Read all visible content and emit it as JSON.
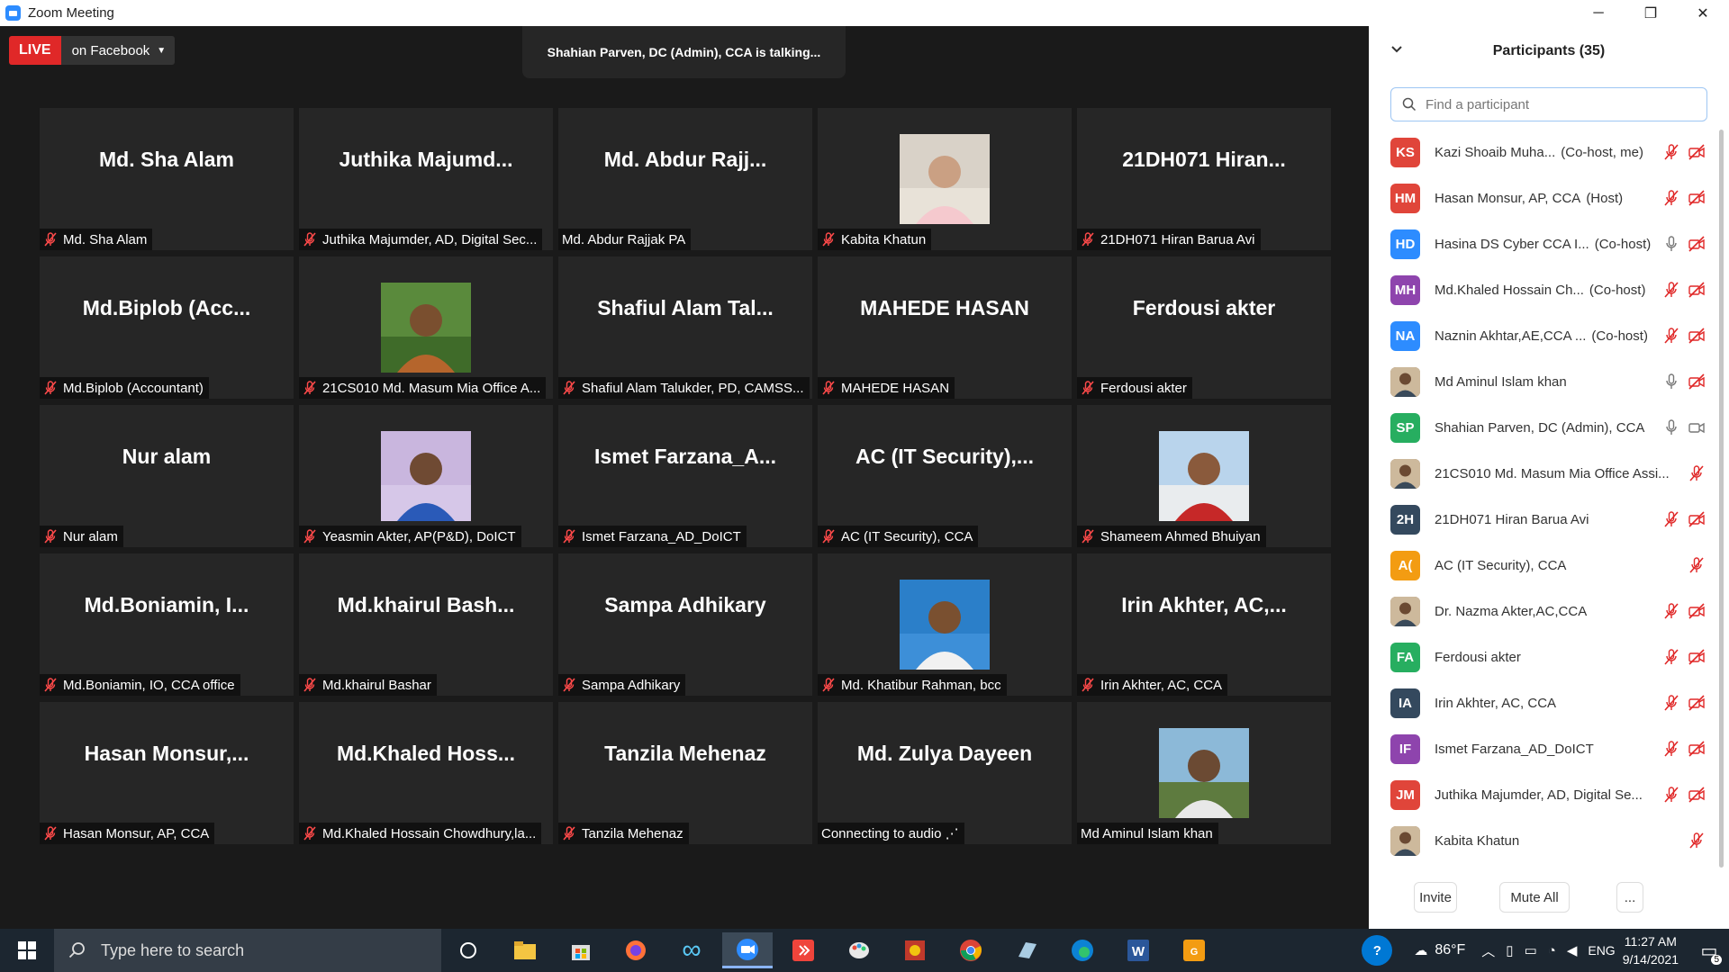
{
  "window": {
    "title": "Zoom Meeting"
  },
  "live": {
    "badge": "LIVE",
    "platform": "on Facebook"
  },
  "talking": "Shahian Parven, DC (Admin), CCA is talking...",
  "tiles": [
    {
      "big": "Md. Sha Alam",
      "label": "Md. Sha Alam",
      "muted": true,
      "photo": null
    },
    {
      "big": "Juthika  Majumd...",
      "label": "Juthika Majumder, AD,  Digital Sec...",
      "muted": true,
      "photo": null
    },
    {
      "big": "Md.  Abdur  Rajj...",
      "label": "Md. Abdur Rajjak PA",
      "muted": false,
      "photo": null
    },
    {
      "big": "",
      "label": "Kabita Khatun",
      "muted": true,
      "photo": "woman-hijab"
    },
    {
      "big": "21DH071  Hiran...",
      "label": "21DH071 Hiran Barua Avi",
      "muted": true,
      "photo": null
    },
    {
      "big": "Md.Biplob  (Acc...",
      "label": "Md.Biplob (Accountant)",
      "muted": true,
      "photo": null
    },
    {
      "big": "",
      "label": "21CS010 Md. Masum Mia Office A...",
      "muted": true,
      "photo": "man-outdoor"
    },
    {
      "big": "Shafiul  Alam  Tal...",
      "label": "Shafiul Alam Talukder, PD, CAMSS...",
      "muted": true,
      "photo": null
    },
    {
      "big": "MAHEDE HASAN",
      "label": "MAHEDE HASAN",
      "muted": true,
      "photo": null
    },
    {
      "big": "Ferdousi akter",
      "label": "Ferdousi akter",
      "muted": true,
      "photo": null
    },
    {
      "big": "Nur alam",
      "label": "Nur alam",
      "muted": true,
      "photo": null
    },
    {
      "big": "",
      "label": "Yeasmin Akter, AP(P&D), DoICT",
      "muted": true,
      "photo": "woman-portrait"
    },
    {
      "big": "Ismet  Farzana_A...",
      "label": "Ismet Farzana_AD_DoICT",
      "muted": true,
      "photo": null
    },
    {
      "big": "AC  (IT  Security),...",
      "label": "AC (IT Security), CCA",
      "muted": true,
      "photo": null
    },
    {
      "big": "",
      "label": "Shameem Ahmed Bhuiyan",
      "muted": true,
      "photo": "taj-mahal"
    },
    {
      "big": "Md.Boniamin,  I...",
      "label": "Md.Boniamin, IO, CCA office",
      "muted": true,
      "photo": null
    },
    {
      "big": "Md.khairul  Bash...",
      "label": "Md.khairul Bashar",
      "muted": true,
      "photo": null
    },
    {
      "big": "Sampa Adhikary",
      "label": "Sampa Adhikary",
      "muted": true,
      "photo": null
    },
    {
      "big": "",
      "label": "Md. Khatibur Rahman, bcc",
      "muted": true,
      "photo": "man-blue-bg"
    },
    {
      "big": "Irin  Akhter,  AC,...",
      "label": "Irin Akhter, AC, CCA",
      "muted": true,
      "photo": null
    },
    {
      "big": "Hasan  Monsur,...",
      "label": "Hasan Monsur, AP, CCA",
      "muted": true,
      "photo": null
    },
    {
      "big": "Md.Khaled  Hoss...",
      "label": "Md.Khaled Hossain Chowdhury,la...",
      "muted": true,
      "photo": null
    },
    {
      "big": "Tanzila Mehenaz",
      "label": "Tanzila Mehenaz",
      "muted": true,
      "photo": null
    },
    {
      "big": "Md.  Zulya Dayeen",
      "label": "Connecting to audio  ⋰",
      "muted": false,
      "photo": null
    },
    {
      "big": "",
      "label": "Md Aminul Islam khan",
      "muted": false,
      "photo": "man-mask"
    }
  ],
  "panel": {
    "title": "Participants (35)",
    "search_placeholder": "Find a participant",
    "participants": [
      {
        "initials": "KS",
        "color": "#e0453a",
        "name": "Kazi Shoaib Muha...",
        "role": "(Co-host, me)",
        "mic": "muted",
        "cam": "off"
      },
      {
        "initials": "HM",
        "color": "#e0453a",
        "name": "Hasan Monsur, AP, CCA",
        "role": "(Host)",
        "mic": "muted",
        "cam": "off"
      },
      {
        "initials": "HD",
        "color": "#2d8cff",
        "name": "Hasina DS Cyber CCA I...",
        "role": "(Co-host)",
        "mic": "on",
        "cam": "off"
      },
      {
        "initials": "MH",
        "color": "#8e44ad",
        "name": "Md.Khaled Hossain Ch...",
        "role": "(Co-host)",
        "mic": "muted",
        "cam": "off"
      },
      {
        "initials": "NA",
        "color": "#2d8cff",
        "name": "Naznin Akhtar,AE,CCA ...",
        "role": "(Co-host)",
        "mic": "muted",
        "cam": "off"
      },
      {
        "initials": "",
        "color": "photo",
        "name": "Md Aminul Islam khan",
        "role": "",
        "mic": "on",
        "cam": "off"
      },
      {
        "initials": "SP",
        "color": "#27ae60",
        "name": "Shahian Parven, DC (Admin), CCA",
        "role": "",
        "mic": "on",
        "cam": "on"
      },
      {
        "initials": "",
        "color": "photo",
        "name": "21CS010 Md. Masum Mia Office Assi...",
        "role": "",
        "mic": "muted",
        "cam": "none"
      },
      {
        "initials": "2H",
        "color": "#34495e",
        "name": "21DH071 Hiran Barua Avi",
        "role": "",
        "mic": "muted",
        "cam": "off"
      },
      {
        "initials": "A(",
        "color": "#f39c12",
        "name": "AC (IT Security), CCA",
        "role": "",
        "mic": "muted",
        "cam": "none"
      },
      {
        "initials": "",
        "color": "photo",
        "name": "Dr. Nazma Akter,AC,CCA",
        "role": "",
        "mic": "muted",
        "cam": "off"
      },
      {
        "initials": "FA",
        "color": "#27ae60",
        "name": "Ferdousi akter",
        "role": "",
        "mic": "muted",
        "cam": "off"
      },
      {
        "initials": "IA",
        "color": "#34495e",
        "name": "Irin Akhter, AC, CCA",
        "role": "",
        "mic": "muted",
        "cam": "off"
      },
      {
        "initials": "IF",
        "color": "#8e44ad",
        "name": "Ismet Farzana_AD_DoICT",
        "role": "",
        "mic": "muted",
        "cam": "off"
      },
      {
        "initials": "JM",
        "color": "#e0453a",
        "name": "Juthika Majumder, AD,  Digital Se...",
        "role": "",
        "mic": "muted",
        "cam": "off"
      },
      {
        "initials": "",
        "color": "photo",
        "name": "Kabita Khatun",
        "role": "",
        "mic": "muted",
        "cam": "none"
      }
    ],
    "invite_label": "Invite",
    "mute_all_label": "Mute All",
    "more_label": "..."
  },
  "taskbar": {
    "search_placeholder": "Type here to search",
    "weather": "86°F",
    "lang": "ENG",
    "time": "11:27 AM",
    "date": "9/14/2021",
    "notifications": "5"
  }
}
